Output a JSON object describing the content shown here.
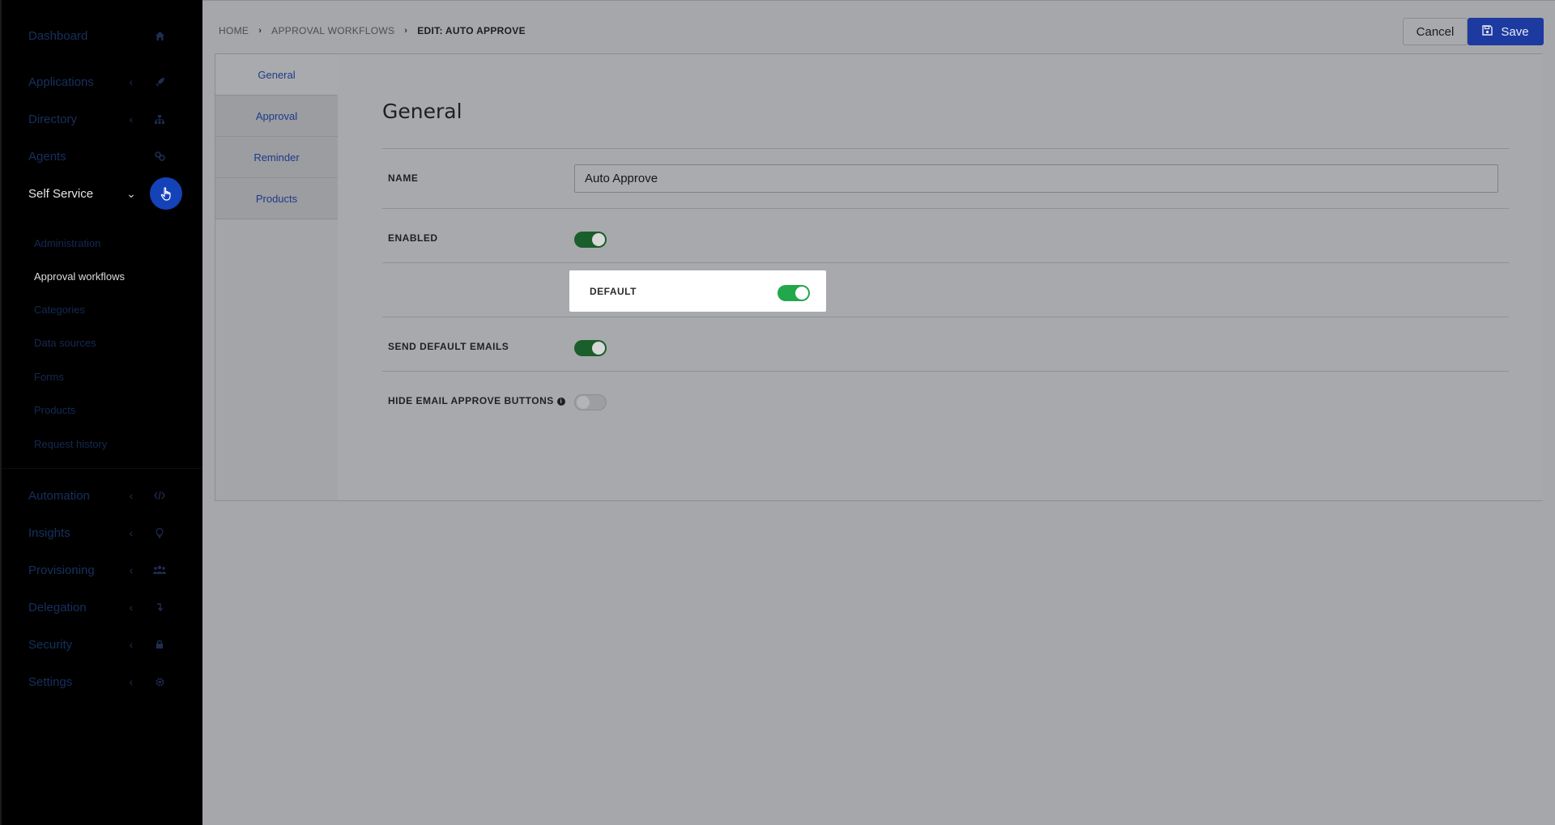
{
  "sidebar": {
    "items": [
      {
        "label": "Dashboard",
        "icon": "home-icon",
        "chevron": ""
      },
      {
        "label": "Applications",
        "icon": "rocket-icon",
        "chevron": "‹"
      },
      {
        "label": "Directory",
        "icon": "org-chart-icon",
        "chevron": "‹"
      },
      {
        "label": "Agents",
        "icon": "agents-icon",
        "chevron": ""
      },
      {
        "label": "Self Service",
        "icon": "hand-pointer-icon",
        "chevron": "⌄"
      },
      {
        "label": "Automation",
        "icon": "code-icon",
        "chevron": "‹"
      },
      {
        "label": "Insights",
        "icon": "lightbulb-icon",
        "chevron": "‹"
      },
      {
        "label": "Provisioning",
        "icon": "users-icon",
        "chevron": "‹"
      },
      {
        "label": "Delegation",
        "icon": "delegation-icon",
        "chevron": "‹"
      },
      {
        "label": "Security",
        "icon": "lock-icon",
        "chevron": "‹"
      },
      {
        "label": "Settings",
        "icon": "gear-icon",
        "chevron": "‹"
      }
    ],
    "self_service_sub": [
      "Administration",
      "Approval workflows",
      "Categories",
      "Data sources",
      "Forms",
      "Products",
      "Request history"
    ]
  },
  "breadcrumb": {
    "home": "HOME",
    "parent": "APPROVAL WORKFLOWS",
    "current": "EDIT: AUTO APPROVE"
  },
  "actions": {
    "cancel": "Cancel",
    "save": "Save"
  },
  "tabs": [
    "General",
    "Approval",
    "Reminder",
    "Products"
  ],
  "content": {
    "title": "General",
    "name_label": "NAME",
    "name_value": "Auto Approve",
    "enabled_label": "ENABLED",
    "enabled": true,
    "default_label": "DEFAULT",
    "default": true,
    "send_emails_label": "SEND DEFAULT EMAILS",
    "send_emails": true,
    "hide_buttons_label": "HIDE EMAIL APPROVE BUTTONS",
    "hide_buttons": false
  },
  "colors": {
    "accent": "#1442b8",
    "toggle_on": "#22a84a",
    "sidebar_bg": "#000000"
  }
}
